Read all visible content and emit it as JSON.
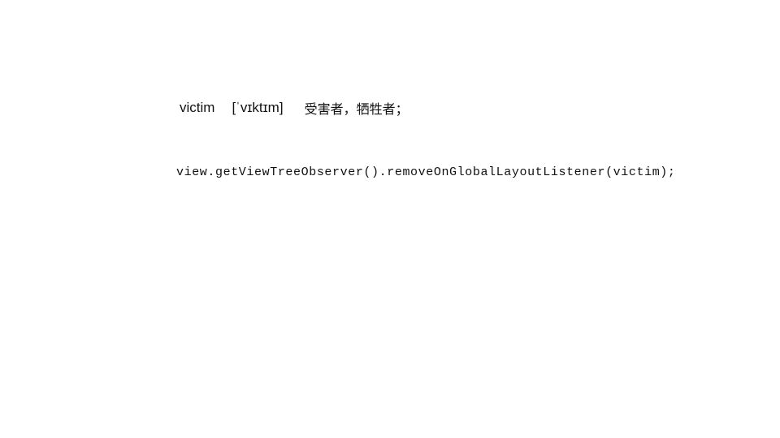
{
  "vocab": {
    "word": "victim",
    "phonetic": "[ˈvɪktɪm]",
    "meaning": "受害者，牺牲者；"
  },
  "code": {
    "line": "view.getViewTreeObserver().removeOnGlobalLayoutListener(victim);"
  }
}
